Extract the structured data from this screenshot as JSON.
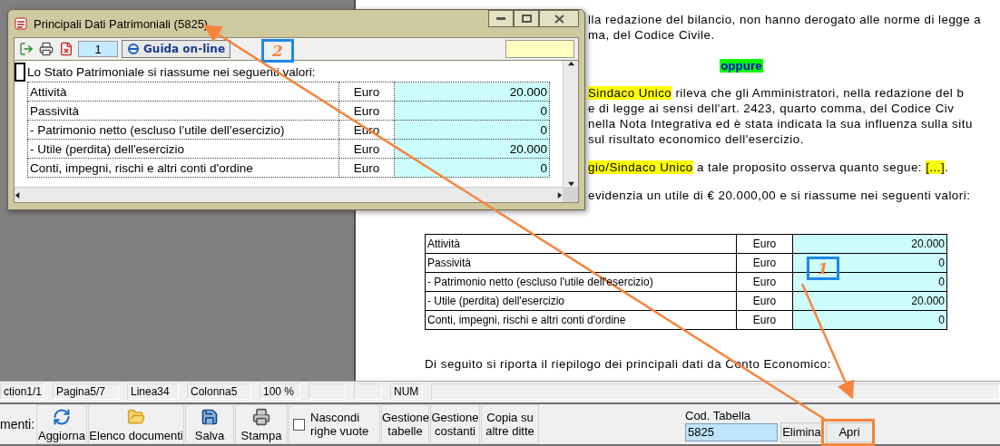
{
  "dialog": {
    "title": "Principali Dati Patrimoniali (5825)",
    "page_field": "1",
    "help_button": "Guida on-line",
    "intro": "Lo Stato Patrimoniale si riassume nei seguenti valori:",
    "rows": [
      {
        "label": "Attività",
        "unit": "Euro",
        "value": "20.000"
      },
      {
        "label": "Passività",
        "unit": "Euro",
        "value": "0"
      },
      {
        "label": "- Patrimonio netto (escluso l’utile dell’esercizio)",
        "unit": "Euro",
        "value": "0"
      },
      {
        "label": "- Utile (perdita) dell'esercizio",
        "unit": "Euro",
        "value": "20.000"
      },
      {
        "label": "Conti, impegni, rischi e altri conti d'ordine",
        "unit": "Euro",
        "value": "0"
      }
    ]
  },
  "document": {
    "blocks": [
      {
        "kind": "text",
        "lines": [
          [
            {
              "text": "lla redazione del bilancio, non hanno derogato alle norme di legge a",
              "highlighted": false
            }
          ],
          [
            {
              "text": "ma, del Codice Civile.",
              "highlighted": false
            }
          ]
        ]
      },
      {
        "kind": "separator",
        "text": "oppure"
      },
      {
        "kind": "text",
        "lines": [
          [
            {
              "text": "Sindaco Unico",
              "highlighted": true
            },
            {
              "text": " rileva che gli Amministratori, nella redazione del b",
              "highlighted": false
            }
          ],
          [
            {
              "text": "e di legge ai sensi dell'art. 2423, quarto comma, del Codice Civ",
              "highlighted": false
            }
          ],
          [
            {
              "text": "nella Nota Integrativa ed è stata indicata la sua influenza sulla situ",
              "highlighted": false
            }
          ],
          [
            {
              "text": "sul risultato economico dell'esercizio.",
              "highlighted": false
            }
          ]
        ]
      },
      {
        "kind": "text",
        "lines": [
          [
            {
              "text": "gio/Sindaco Unico",
              "highlighted": true
            },
            {
              "text": " a tale proposito osserva quanto segue: ",
              "highlighted": false
            },
            {
              "text": "[...]",
              "highlighted": true
            },
            {
              "text": ".",
              "highlighted": false
            }
          ]
        ]
      },
      {
        "kind": "text",
        "lines": [
          [
            {
              "text": "evidenzia un utile di € 20.000,00 e si riassume nei seguenti valori:",
              "highlighted": false
            }
          ]
        ]
      }
    ],
    "table": [
      {
        "label": "Attività",
        "unit": "Euro",
        "value": "20.000"
      },
      {
        "label": "Passività",
        "unit": "Euro",
        "value": "0"
      },
      {
        "label": "- Patrimonio netto (escluso l'utile dell'esercizio)",
        "unit": "Euro",
        "value": "0"
      },
      {
        "label": "- Utile (perdita) dell'esercizio",
        "unit": "Euro",
        "value": "20.000"
      },
      {
        "label": "Conti, impegni, rischi e altri conti d'ordine",
        "unit": "Euro",
        "value": "0"
      }
    ],
    "closing": "Di seguito si riporta il riepilogo dei principali dati da Conto Economico:"
  },
  "status_bar": [
    "ction1/1",
    "Pagina5/7",
    "Linea34",
    "Colonna5",
    "100 %",
    "NUM"
  ],
  "toolbar": {
    "label": "menti:",
    "items": [
      {
        "kind": "icon",
        "label": "Aggiorna"
      },
      {
        "kind": "icon",
        "label": "Elenco documenti"
      },
      {
        "kind": "icon",
        "label": "Salva"
      },
      {
        "kind": "icon",
        "label": "Stampa"
      },
      {
        "kind": "checkbox",
        "label": "Nascondi righe vuote",
        "checked": false
      },
      {
        "kind": "text",
        "label": "Gestione tabelle"
      },
      {
        "kind": "text",
        "label": "Gestione costanti"
      },
      {
        "kind": "text",
        "label": "Copia su altre ditte"
      }
    ],
    "code_label": "Cod. Tabella",
    "code_value": "5825",
    "buttons": [
      "Elimina",
      "Apri"
    ]
  },
  "annotations": [
    {
      "label": "2"
    },
    {
      "label": "1"
    }
  ]
}
